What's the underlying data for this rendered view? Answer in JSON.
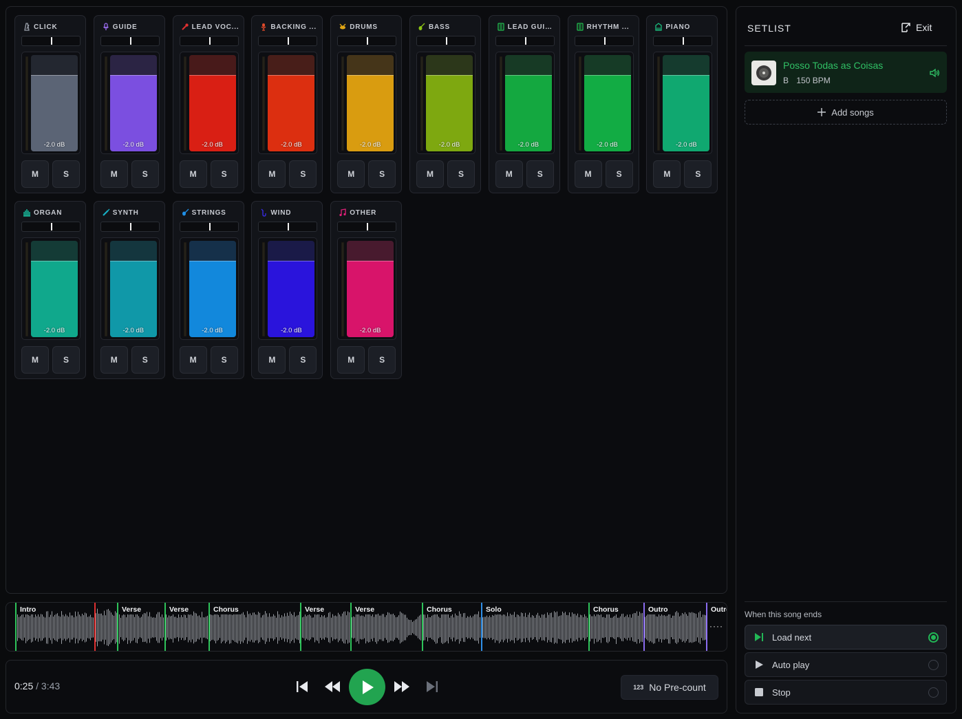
{
  "mixer": {
    "channels": [
      {
        "name": "CLICK",
        "icon": "metronome-icon",
        "db": "-2.0 dB",
        "mute": "M",
        "solo": "S",
        "color": "#5b6475",
        "top_color": "#232730",
        "icon_color": "#9aa0aa"
      },
      {
        "name": "GUIDE",
        "icon": "microphone-icon",
        "db": "-2.0 dB",
        "mute": "M",
        "solo": "S",
        "color": "#7b4fe0",
        "top_color": "#2b2444",
        "icon_color": "#9b6cf0"
      },
      {
        "name": "LEAD VOC...",
        "icon": "lead-mic-icon",
        "db": "-2.0 dB",
        "mute": "M",
        "solo": "S",
        "color": "#d91f14",
        "top_color": "#481a1a",
        "icon_color": "#e03030"
      },
      {
        "name": "BACKING ...",
        "icon": "backing-vocal-icon",
        "db": "-2.0 dB",
        "mute": "M",
        "solo": "S",
        "color": "#dc2f10",
        "top_color": "#481e19",
        "icon_color": "#e04a2a"
      },
      {
        "name": "DRUMS",
        "icon": "drums-icon",
        "db": "-2.0 dB",
        "mute": "M",
        "solo": "S",
        "color": "#d99c10",
        "top_color": "#453519",
        "icon_color": "#e0a514"
      },
      {
        "name": "BASS",
        "icon": "bass-guitar-icon",
        "db": "-2.0 dB",
        "mute": "M",
        "solo": "S",
        "color": "#7ea810",
        "top_color": "#2c371a",
        "icon_color": "#8cc414"
      },
      {
        "name": "LEAD GUIT...",
        "icon": "amp-icon",
        "db": "-2.0 dB",
        "mute": "M",
        "solo": "S",
        "color": "#14a840",
        "top_color": "#173a25",
        "icon_color": "#22c050"
      },
      {
        "name": "RHYTHM ...",
        "icon": "amp-icon",
        "db": "-2.0 dB",
        "mute": "M",
        "solo": "S",
        "color": "#12ac44",
        "top_color": "#163b26",
        "icon_color": "#22c050"
      },
      {
        "name": "PIANO",
        "icon": "piano-icon",
        "db": "-2.0 dB",
        "mute": "M",
        "solo": "S",
        "color": "#10a870",
        "top_color": "#153b2e",
        "icon_color": "#1cc080"
      },
      {
        "name": "ORGAN",
        "icon": "organ-icon",
        "db": "-2.0 dB",
        "mute": "M",
        "solo": "S",
        "color": "#10a88c",
        "top_color": "#143b36",
        "icon_color": "#18c0a0"
      },
      {
        "name": "SYNTH",
        "icon": "synth-icon",
        "db": "-2.0 dB",
        "mute": "M",
        "solo": "S",
        "color": "#1098a8",
        "top_color": "#14363e",
        "icon_color": "#18b0c4"
      },
      {
        "name": "STRINGS",
        "icon": "violin-icon",
        "db": "-2.0 dB",
        "mute": "M",
        "solo": "S",
        "color": "#1288dc",
        "top_color": "#15304a",
        "icon_color": "#2090e8"
      },
      {
        "name": "WIND",
        "icon": "saxophone-icon",
        "db": "-2.0 dB",
        "mute": "M",
        "solo": "S",
        "color": "#2a14dc",
        "top_color": "#1a1a48",
        "icon_color": "#3a2cf0"
      },
      {
        "name": "OTHER",
        "icon": "music-note-icon",
        "db": "-2.0 dB",
        "mute": "M",
        "solo": "S",
        "color": "#d8146a",
        "top_color": "#481a2e",
        "icon_color": "#e02078"
      }
    ]
  },
  "timeline": {
    "sections": [
      {
        "label": "Intro",
        "color": "#2ec35a"
      },
      {
        "label": "",
        "color": "#e03030"
      },
      {
        "label": "Verse",
        "color": "#2ec35a"
      },
      {
        "label": "Verse",
        "color": "#2ec35a"
      },
      {
        "label": "Chorus",
        "color": "#2ec35a"
      },
      {
        "label": "Verse",
        "color": "#2ec35a"
      },
      {
        "label": "Verse",
        "color": "#2ec35a"
      },
      {
        "label": "Chorus",
        "color": "#2ec35a"
      },
      {
        "label": "Solo",
        "color": "#2f8fe8"
      },
      {
        "label": "Chorus",
        "color": "#2ec35a"
      },
      {
        "label": "Outro",
        "color": "#8a6cf0"
      },
      {
        "label": "Outro",
        "color": "#8a6cf0"
      }
    ],
    "more": "····"
  },
  "transport": {
    "current_time": "0:25",
    "separator": "/",
    "total_time": "3:43",
    "precount_icon_text": "123",
    "precount_label": "No Pre-count",
    "play_color": "#22a450"
  },
  "setlist": {
    "title": "SETLIST",
    "exit_label": "Exit",
    "songs": [
      {
        "title": "Posso Todas as Coisas",
        "key": "B",
        "bpm": "150 BPM",
        "active": true
      }
    ],
    "add_songs_label": "Add songs",
    "end_label": "When this song ends",
    "end_options": [
      {
        "label": "Load next",
        "icon": "skip-next-icon",
        "selected": true
      },
      {
        "label": "Auto play",
        "icon": "play-icon",
        "selected": false
      },
      {
        "label": "Stop",
        "icon": "stop-icon",
        "selected": false
      }
    ],
    "accent_color": "#22b856"
  }
}
